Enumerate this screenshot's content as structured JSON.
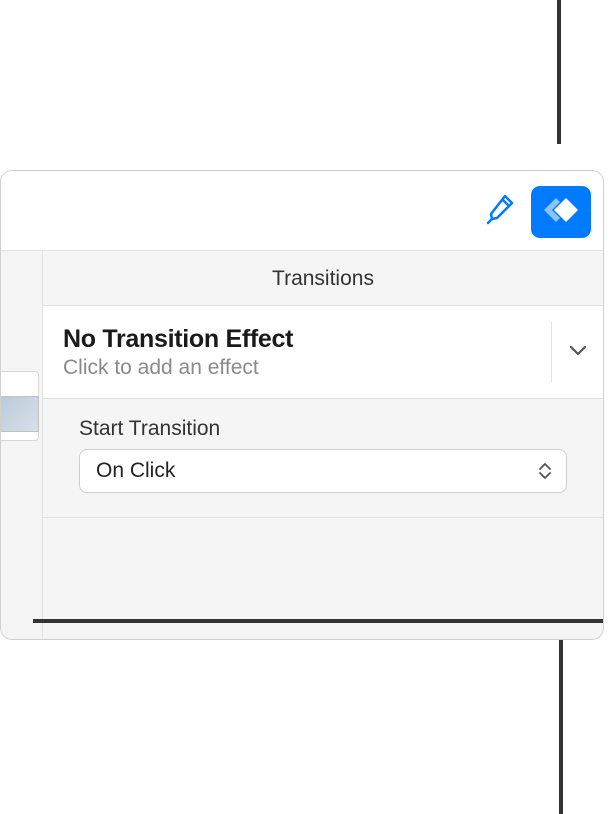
{
  "header": {
    "title": "Transitions"
  },
  "effect": {
    "title": "No Transition Effect",
    "subtitle": "Click to add an effect"
  },
  "start": {
    "label": "Start Transition",
    "value": "On Click"
  }
}
